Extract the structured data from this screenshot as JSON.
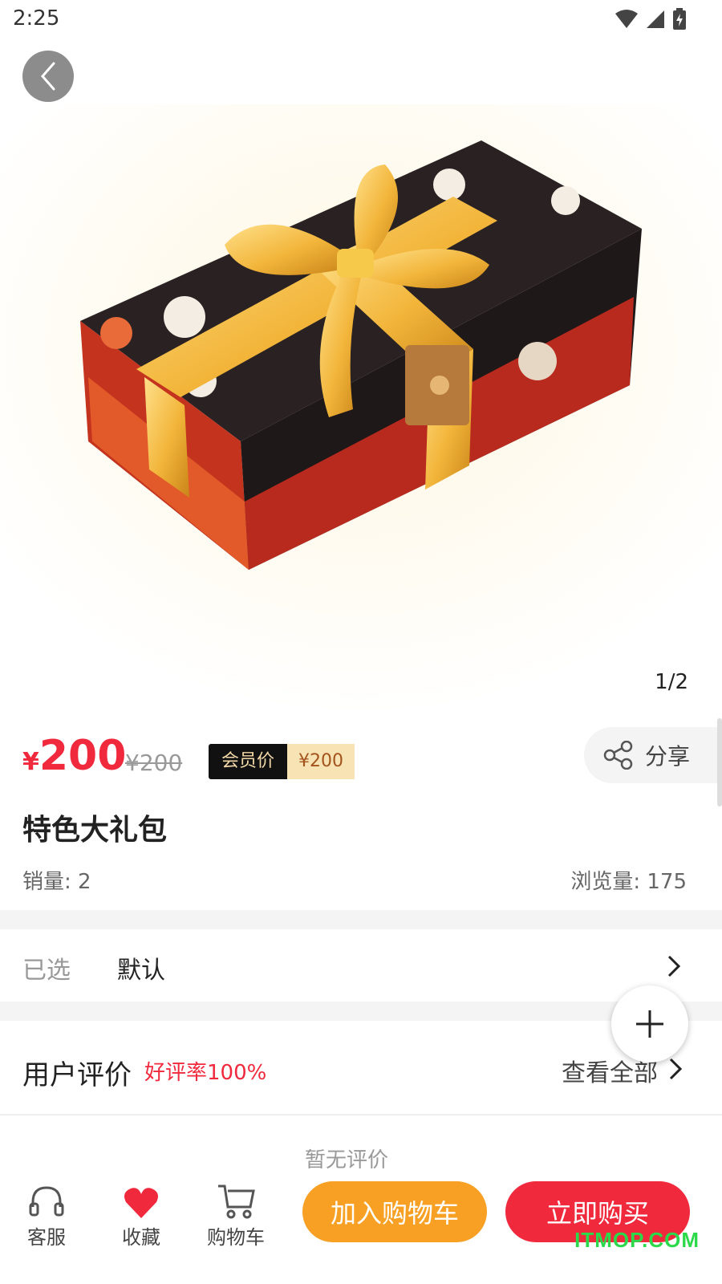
{
  "status_bar": {
    "time": "2:25"
  },
  "gallery": {
    "pager": "1/2"
  },
  "product": {
    "currency": "¥",
    "price": "200",
    "original_price": "¥200",
    "member_label": "会员价",
    "member_price": "¥200",
    "title": "特色大礼包",
    "sales": "销量: 2",
    "views": "浏览量: 175"
  },
  "share": {
    "label": "分享"
  },
  "spec": {
    "key": "已选",
    "value": "默认"
  },
  "reviews": {
    "title": "用户评价",
    "positive_rate": "好评率100%",
    "view_all": "查看全部",
    "empty_text": "暂无评价"
  },
  "bottom_bar": {
    "service": "客服",
    "favorite": "收藏",
    "cart": "购物车",
    "add_to_cart": "加入购物车",
    "buy_now": "立即购买"
  },
  "watermark": "ITMOP.COM",
  "colors": {
    "accent_red": "#f0293d",
    "accent_orange": "#f8a023",
    "member_gold": "#f8e3b5"
  }
}
